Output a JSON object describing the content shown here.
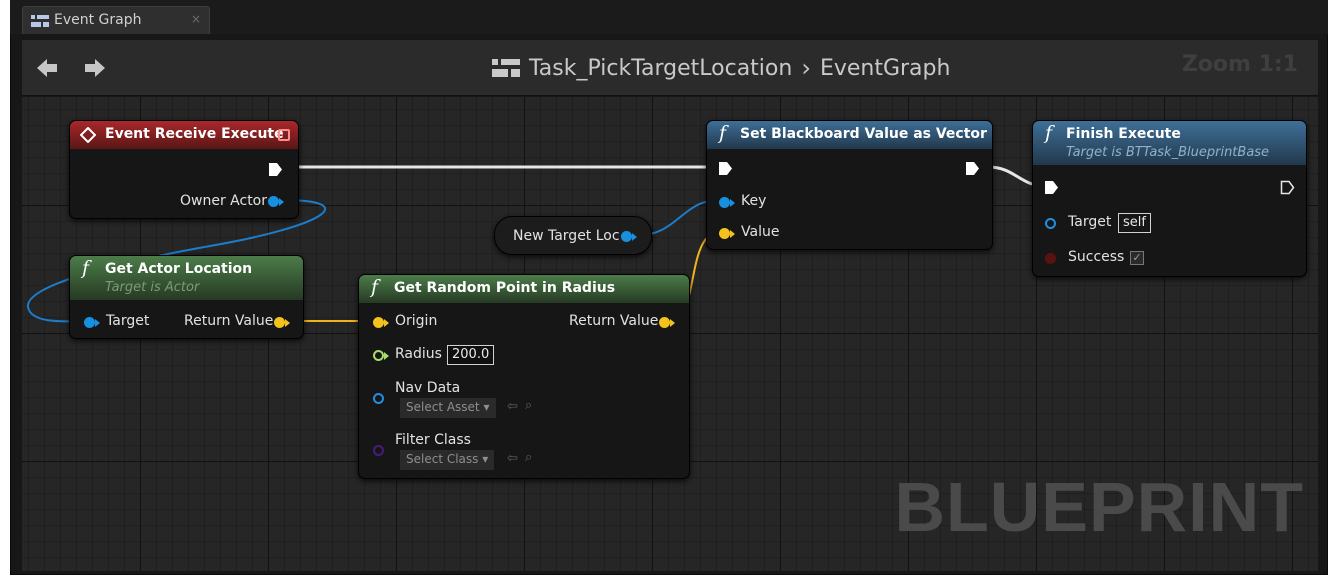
{
  "tab": {
    "label": "Event Graph",
    "close": "×"
  },
  "header": {
    "breadcrumb_asset": "Task_PickTargetLocation",
    "breadcrumb_separator": "›",
    "breadcrumb_graph": "EventGraph",
    "zoom": "Zoom 1:1"
  },
  "watermark": "BLUEPRINT",
  "nodes": {
    "event_receive_execute": {
      "title": "Event Receive Execute",
      "pins": {
        "owner_actor": "Owner Actor"
      },
      "header_color": "#a8282a"
    },
    "get_actor_location": {
      "title": "Get Actor Location",
      "subtitle": "Target is Actor",
      "pins": {
        "target": "Target",
        "return_value": "Return Value"
      },
      "header_color": "#4c7c49"
    },
    "new_target_loc": {
      "label": "New Target Loc"
    },
    "get_random_point": {
      "title": "Get Random Point in Radius",
      "pins": {
        "origin": "Origin",
        "return_value": "Return Value",
        "radius": "Radius",
        "radius_value": "200.0",
        "nav_data": "Nav Data",
        "nav_data_select": "Select Asset",
        "filter_class": "Filter Class",
        "filter_class_select": "Select Class"
      }
    },
    "set_blackboard_vector": {
      "title": "Set Blackboard Value as Vector",
      "pins": {
        "key": "Key",
        "value": "Value"
      },
      "header_color": "#3e6f97"
    },
    "finish_execute": {
      "title": "Finish Execute",
      "subtitle": "Target is BTTask_BlueprintBase",
      "pins": {
        "target": "Target",
        "target_value": "self",
        "success": "Success",
        "success_checked": "✓"
      }
    }
  },
  "colors": {
    "object_pin": "#1790e0",
    "vector_pin": "#f3c31b",
    "float_pin": "#a6e06a",
    "exec_wire": "#e8e8e8"
  }
}
